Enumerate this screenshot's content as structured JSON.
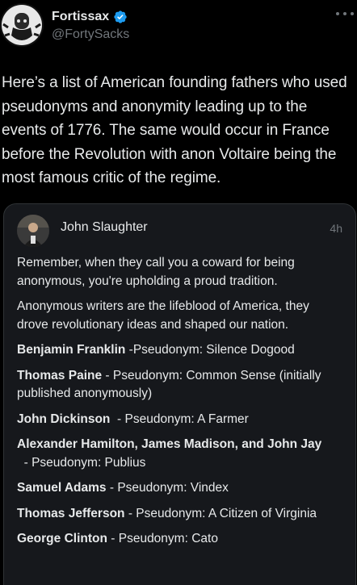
{
  "author": {
    "display_name": "Fortissax",
    "handle": "@FortySacks",
    "verified_color": "#1d9bf0"
  },
  "tweet": {
    "text": "Here’s a list of American founding fathers who used pseudonyms and anonymity leading up to the events of 1776. The same would occur in France before the Revolution with anon Voltaire being the most famous critic of the regime."
  },
  "quote": {
    "author_name": "John Slaughter",
    "time": "4h",
    "intro": "Remember, when they call you a coward for being anonymous, you're upholding a proud tradition.",
    "intro2": "Anonymous writers are the lifeblood of America, they drove revolutionary ideas and shaped our nation.",
    "items": [
      {
        "name": "Benjamin Franklin",
        "sep": " -",
        "rest": "Pseudonym: Silence Dogood"
      },
      {
        "name": "Thomas Paine",
        "sep": " - ",
        "rest": "Pseudonym: Common Sense (initially published anonymously)"
      },
      {
        "name": "John Dickinson",
        "sep": "  - ",
        "rest": "Pseudonym: A Farmer"
      },
      {
        "name": "Alexander Hamilton, James Madison, and John Jay",
        "sep": "  - ",
        "rest": "Pseudonym: Publius"
      },
      {
        "name": "Samuel Adams",
        "sep": " - ",
        "rest": "Pseudonym: Vindex"
      },
      {
        "name": "Thomas Jefferson",
        "sep": " - ",
        "rest": "Pseudonym: A Citizen of Virginia"
      },
      {
        "name": "George Clinton",
        "sep": " - ",
        "rest": "Pseudonym: Cato"
      }
    ]
  }
}
